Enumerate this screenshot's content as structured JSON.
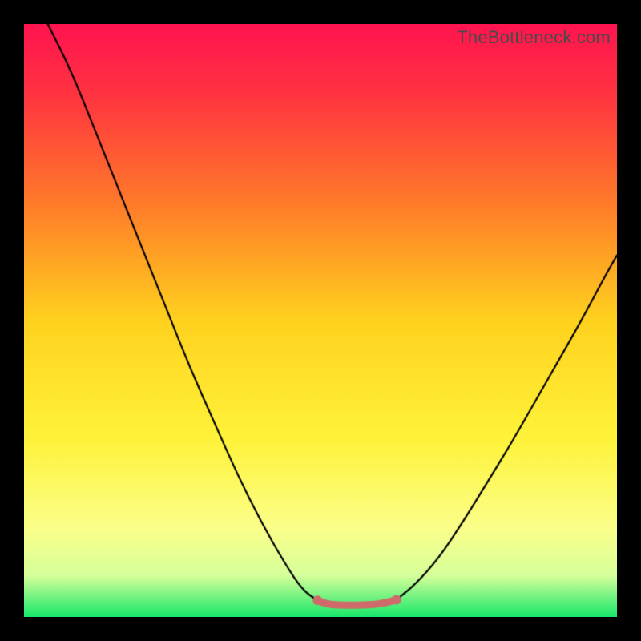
{
  "watermark": "TheBottleneck.com",
  "chart_data": {
    "type": "line",
    "title": "",
    "xlabel": "",
    "ylabel": "",
    "xlim": [
      0,
      100
    ],
    "ylim": [
      0,
      100
    ],
    "grid": false,
    "legend": false,
    "gradient_stops": [
      {
        "pos": 0.0,
        "color": "#ff1450"
      },
      {
        "pos": 0.12,
        "color": "#ff3440"
      },
      {
        "pos": 0.3,
        "color": "#ff7a2a"
      },
      {
        "pos": 0.5,
        "color": "#ffd21e"
      },
      {
        "pos": 0.7,
        "color": "#fff33a"
      },
      {
        "pos": 0.85,
        "color": "#fbff8a"
      },
      {
        "pos": 0.93,
        "color": "#d6ff9a"
      },
      {
        "pos": 1.0,
        "color": "#17e86a"
      }
    ],
    "series": [
      {
        "name": "left-limb",
        "color": "#000000",
        "x": [
          4,
          8,
          12,
          16,
          20,
          24,
          28,
          32,
          36,
          40,
          44,
          47,
          49.5
        ],
        "y": [
          100,
          92,
          82,
          72,
          62,
          52,
          42,
          33,
          24,
          16,
          9,
          4.5,
          2.8
        ]
      },
      {
        "name": "flat-bottom",
        "color": "#d06a6a",
        "x": [
          49.5,
          51,
          53,
          55,
          57,
          59,
          61,
          62.8
        ],
        "y": [
          2.8,
          2.2,
          2.0,
          2.0,
          2.0,
          2.1,
          2.4,
          2.9
        ]
      },
      {
        "name": "right-limb",
        "color": "#000000",
        "x": [
          62.8,
          66,
          70,
          74,
          78,
          82,
          86,
          90,
          94,
          98,
          100
        ],
        "y": [
          2.9,
          5.5,
          10,
          16,
          22.5,
          29,
          36,
          43,
          50,
          57.5,
          61
        ]
      }
    ],
    "endpoint_dots": {
      "color": "#d06a6a",
      "radius_px": 6,
      "points": [
        {
          "x": 49.5,
          "y": 2.8
        },
        {
          "x": 62.8,
          "y": 2.9
        }
      ]
    }
  }
}
